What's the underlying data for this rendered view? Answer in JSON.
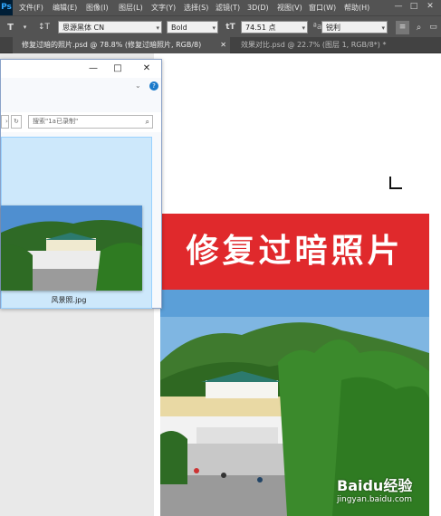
{
  "app": {
    "logo": "Ps"
  },
  "menu": [
    "文件(F)",
    "编辑(E)",
    "图像(I)",
    "图层(L)",
    "文字(Y)",
    "选择(S)",
    "滤镜(T)",
    "3D(D)",
    "视图(V)",
    "窗口(W)",
    "帮助(H)"
  ],
  "window_controls": {
    "minimize": "—",
    "maximize": "□",
    "close": "✕"
  },
  "options": {
    "tool_icon": "T",
    "font_family": "思源黑体 CN",
    "font_style": "Bold",
    "font_size": "74.51 点",
    "antialias": "锐利",
    "size_icon": "tT",
    "orient_icon": "↕T"
  },
  "tabs": [
    {
      "label": "修复过暗的照片.psd @ 78.8% (修复过暗照片, RGB/8)",
      "close": "✕",
      "active": true
    },
    {
      "label": "效果对比.psd @ 22.7% (图层 1, RGB/8*) *",
      "close": "",
      "active": false
    }
  ],
  "document": {
    "banner_text": "修复过暗照片"
  },
  "explorer": {
    "minimize": "—",
    "maximize": "□",
    "close": "✕",
    "help": "?",
    "search_placeholder": "搜索\"1a已录制\"",
    "file_name": "风景照.jpg"
  },
  "watermark": {
    "brand": "Baidu经验",
    "url": "jingyan.baidu.com"
  },
  "icons": [
    "photoshop-logo",
    "text-tool-icon",
    "text-orientation-icon",
    "font-size-icon",
    "search-icon",
    "refresh-icon",
    "help-icon",
    "chevron-down-icon",
    "align-left-icon",
    "search-toolbar-icon",
    "frame-icon"
  ],
  "colors": {
    "banner": "#e0292c",
    "ps_dark": "#535353",
    "explorer_selection": "#cde8fb"
  }
}
